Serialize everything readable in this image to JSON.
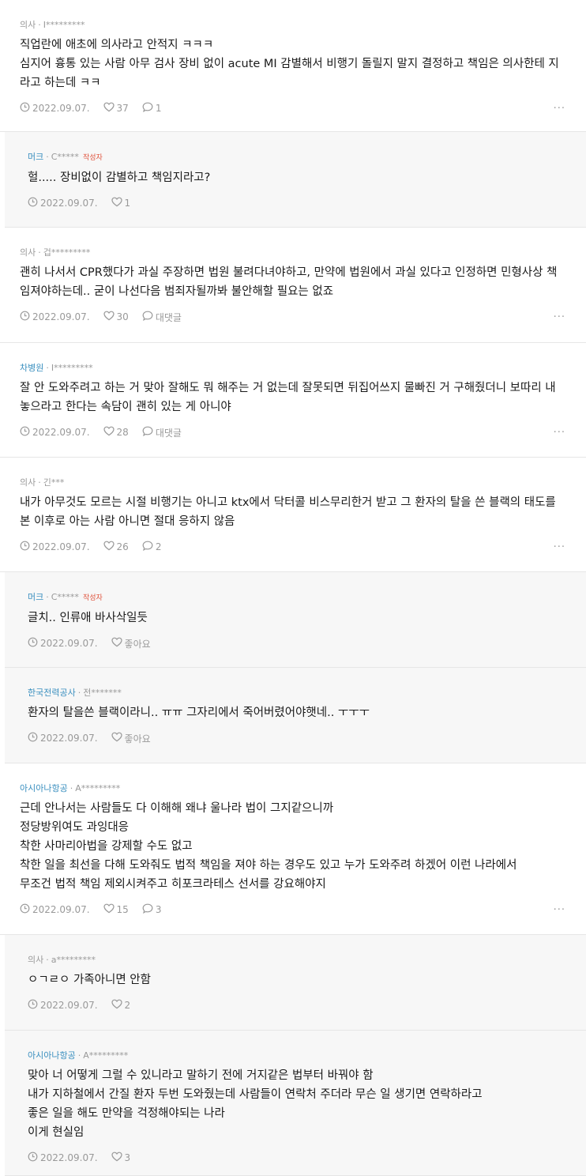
{
  "comments": [
    {
      "job": "의사",
      "job_blue": false,
      "user": "I*********",
      "author": "",
      "reply": false,
      "lines": [
        "직업란에 애초에 의사라고 안적지 ㅋㅋㅋ",
        "심지어 흉통 있는 사람 아무 검사 장비 없이 acute MI 감별해서 비행기 돌릴지 말지 결정하고 책임은 의사한테 지",
        "라고 하는데 ㅋㅋ"
      ],
      "date": "2022.09.07.",
      "likes": "37",
      "replies": "1",
      "more": "···"
    },
    {
      "job": "머크",
      "job_blue": true,
      "user": "C*****",
      "author": "작성자",
      "reply": true,
      "lines": [
        "헐..... 장비없이 감별하고 책임지라고?"
      ],
      "date": "2022.09.07.",
      "likes": "1",
      "replies": "",
      "more": ""
    },
    {
      "job": "의사",
      "job_blue": false,
      "user": "겁*********",
      "author": "",
      "reply": false,
      "lines": [
        "괜히 나서서 CPR했다가 과실 주장하면 법원 불려다녀야하고, 만약에 법원에서 과실 있다고 인정하면 민형사상 책",
        "임져야하는데.. 굳이 나선다음 범죄자될까봐 불안해할 필요는 없죠"
      ],
      "date": "2022.09.07.",
      "likes": "30",
      "replies": "대댓글",
      "more": "···"
    },
    {
      "job": "차병원",
      "job_blue": true,
      "user": "I*********",
      "author": "",
      "reply": false,
      "lines": [
        "잘 안 도와주려고 하는 거 맞아 잘해도 뭐 해주는 거 없는데 잘못되면 뒤집어쓰지 물빠진 거 구해줬더니 보따리 내",
        "놓으라고 한다는 속담이 괜히 있는 게 아니야"
      ],
      "date": "2022.09.07.",
      "likes": "28",
      "replies": "대댓글",
      "more": "···"
    },
    {
      "job": "의사",
      "job_blue": false,
      "user": "긴***",
      "author": "",
      "reply": false,
      "lines": [
        "내가 아무것도 모르는 시절 비행기는 아니고 ktx에서 닥터콜 비스무리한거 받고 그 환자의 탈을 쓴 블랙의 태도를",
        "본 이후로 아는 사람 아니면 절대 응하지 않음"
      ],
      "date": "2022.09.07.",
      "likes": "26",
      "replies": "2",
      "more": "···"
    },
    {
      "job": "머크",
      "job_blue": true,
      "user": "C*****",
      "author": "작성자",
      "reply": true,
      "lines": [
        "글치.. 인류애 바사삭일듯"
      ],
      "date": "2022.09.07.",
      "likes": "좋아요",
      "replies": "",
      "more": ""
    },
    {
      "job": "한국전력공사",
      "job_blue": true,
      "user": "전*******",
      "author": "",
      "reply": true,
      "lines": [
        "환자의 탈을쓴 블랙이라니.. ㅠㅠ 그자리에서 죽어버렸어야햇네.. ㅜㅜㅜ"
      ],
      "date": "2022.09.07.",
      "likes": "좋아요",
      "replies": "",
      "more": ""
    },
    {
      "job": "아시아나항공",
      "job_blue": true,
      "user": "A*********",
      "author": "",
      "reply": false,
      "lines": [
        "근데 안나서는 사람들도 다 이해해 왜냐 울나라 법이 그지같으니까",
        "정당방위여도 과잉대응",
        "착한 사마리아법을 강제할 수도 없고",
        "착한 일을 최선을 다해 도와줘도 법적 책임을 져야 하는 경우도 있고 누가 도와주려 하겠어 이런 나라에서",
        "무조건 법적 책임 제외시켜주고 히포크라테스 선서를 강요해야지"
      ],
      "date": "2022.09.07.",
      "likes": "15",
      "replies": "3",
      "more": "···"
    },
    {
      "job": "의사",
      "job_blue": false,
      "user": "a*********",
      "author": "",
      "reply": true,
      "lines": [
        "ㅇㄱㄹㅇ 가족아니면 안함"
      ],
      "date": "2022.09.07.",
      "likes": "2",
      "replies": "",
      "more": ""
    },
    {
      "job": "아시아나항공",
      "job_blue": true,
      "user": "A*********",
      "author": "",
      "reply": true,
      "lines": [
        "맞아 너 어떻게 그럴 수 있니라고 말하기 전에 거지같은 법부터 바꿔야 함",
        "내가 지하철에서 간질 환자 두번 도와줬는데 사람들이 연락처 주더라 무슨 일 생기면 연락하라고",
        "좋은 일을 해도 만약을 걱정해야되는 나라",
        "이게 현실임"
      ],
      "date": "2022.09.07.",
      "likes": "3",
      "replies": "",
      "more": ""
    }
  ],
  "icons": {
    "date": "clock-icon",
    "likes": "heart-icon",
    "replies": "speech-bubble-icon",
    "more": "more-options-icon"
  }
}
